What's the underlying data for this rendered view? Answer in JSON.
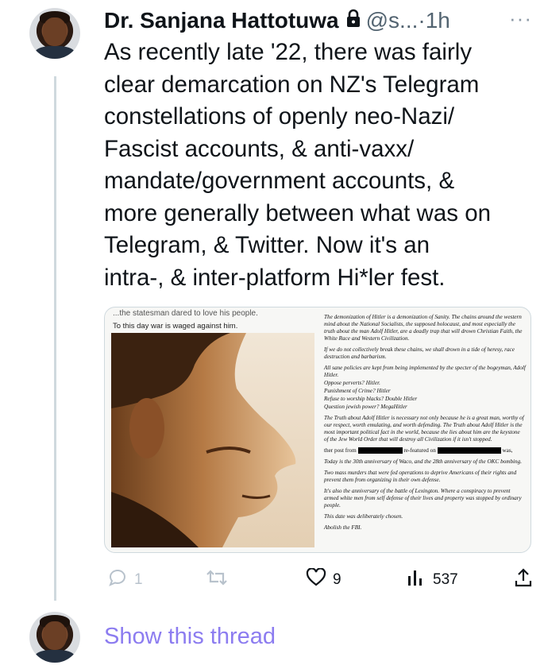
{
  "author": {
    "name": "Dr. Sanjana Hattotuwa",
    "handle": "@s...",
    "separator": "·",
    "time": "1h",
    "more": "···"
  },
  "tweet": {
    "lines": [
      "As recently late '22, there was fairly",
      "clear demarcation on NZ's Telegram",
      "constellations of openly neo-Nazi/",
      "Fascist accounts, & anti-vaxx/",
      "mandate/government accounts, &",
      "more generally between what was on",
      "Telegram, & Twitter. Now it's an",
      "intra-, & inter-platform Hi*ler fest."
    ]
  },
  "media": {
    "top_text": "...the statesman dared to love his people.",
    "caption": "To this day war is waged against him.",
    "doc": {
      "p1": "The demonization of Hitler is a demonization of Sanity. The chains around the western mind about the National Socialists, the supposed holocaust, and most especially the truth about the man Adolf Hitler, are a deadly trap that will drown Christian Faith, the White Race and Western Civilization.",
      "p2": "If we do not collectively break these chains, we shall drown in a tide of heresy, race destruction and barbarism.",
      "p3": "All sane policies are kept from being implemented by the specter of the bogeyman, Adolf Hitler.",
      "p4": "Oppose perverts? Hitler.",
      "p5": "Punishment of Crime? Hitler",
      "p6": "Refuse to worship blacks? Double Hitler",
      "p7": "Question jewish power? MegaHitler",
      "p8": "The Truth about Adolf Hitler is necessary not only because he is a great man, worthy of our respect, worth emulating, and worth defending. The Truth about Adolf Hitler is the most important political fact in the world, because the lies about him are the keystone of the Jew World Order that will destroy all Civilization if it isn't stopped.",
      "p9_a": "ther post from",
      "p9_b": "re-featured on",
      "p9_c": "was,",
      "p10": "Today is the 30th anniversary of Waco, and the 28th anniversary of the OKC bombing.",
      "p11": "Two mass murders that were fed operations to deprive Americans of their rights and prevent them from organizing in their own defense.",
      "p12": "It's also the anniversary of the battle of Lexington. Where a conspiracy to prevent armed white men from self defense of their lives and property was stopped by ordinary people.",
      "p13": "This date was deliberately chosen.",
      "p14": "Abolish the FBI."
    }
  },
  "actions": {
    "reply_count": "1",
    "retweet_count": "",
    "like_count": "9",
    "views_count": "537"
  },
  "thread": {
    "show_label": "Show this thread"
  },
  "colors": {
    "text": "#0f1419",
    "muted": "#536471",
    "line": "#cfd9de",
    "show_thread": "#8c7cf0"
  }
}
